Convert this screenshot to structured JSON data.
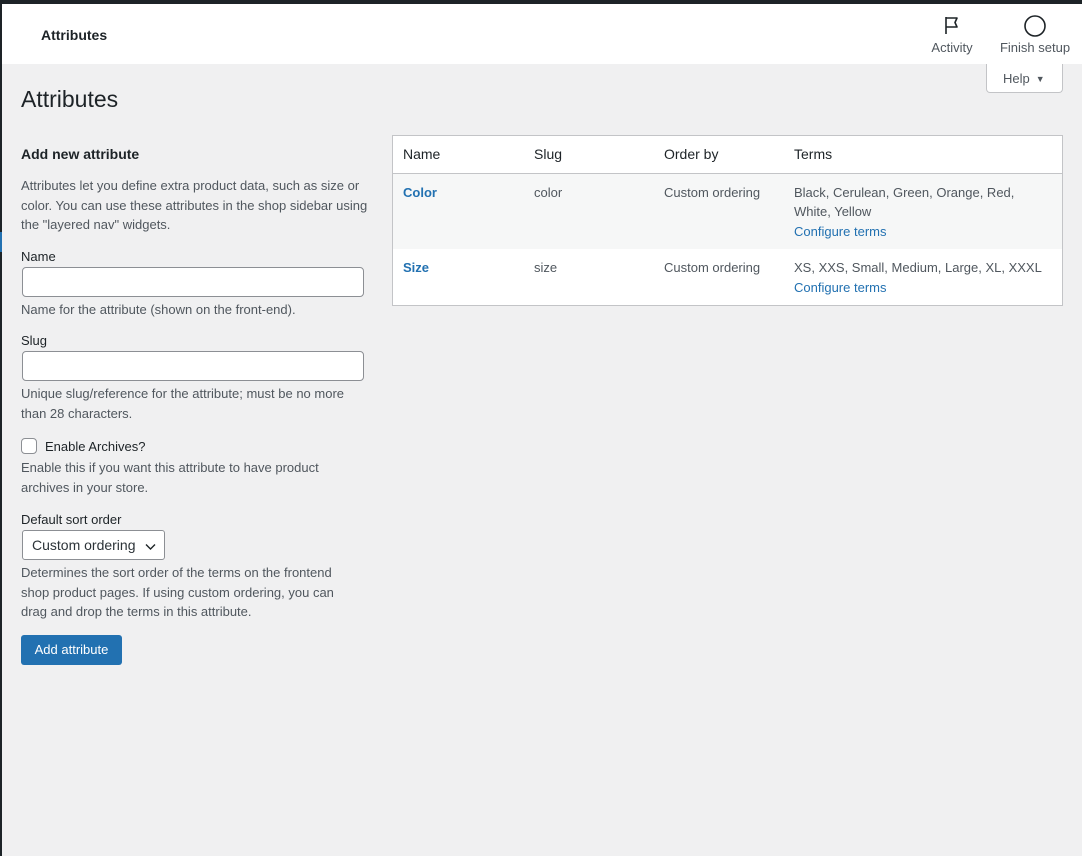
{
  "header": {
    "title": "Attributes",
    "activity_label": "Activity",
    "finish_setup_label": "Finish setup"
  },
  "help": {
    "label": "Help"
  },
  "page": {
    "title": "Attributes"
  },
  "form": {
    "heading": "Add new attribute",
    "intro": "Attributes let you define extra product data, such as size or color. You can use these attributes in the shop sidebar using the \"layered nav\" widgets.",
    "name_label": "Name",
    "name_value": "",
    "name_help": "Name for the attribute (shown on the front-end).",
    "slug_label": "Slug",
    "slug_value": "",
    "slug_help": "Unique slug/reference for the attribute; must be no more than 28 characters.",
    "archives_label": "Enable Archives?",
    "archives_checked": false,
    "archives_help": "Enable this if you want this attribute to have product archives in your store.",
    "sort_label": "Default sort order",
    "sort_value": "Custom ordering",
    "sort_help": "Determines the sort order of the terms on the frontend shop product pages. If using custom ordering, you can drag and drop the terms in this attribute.",
    "submit_label": "Add attribute"
  },
  "table": {
    "columns": [
      "Name",
      "Slug",
      "Order by",
      "Terms"
    ],
    "rows": [
      {
        "name": "Color",
        "slug": "color",
        "order_by": "Custom ordering",
        "terms": "Black, Cerulean, Green, Orange, Red, White, Yellow",
        "configure_label": "Configure terms"
      },
      {
        "name": "Size",
        "slug": "size",
        "order_by": "Custom ordering",
        "terms": "XS, XXS, Small, Medium, Large, XL, XXXL",
        "configure_label": "Configure terms"
      }
    ]
  },
  "colors": {
    "accent": "#2271b1",
    "text": "#1d2327",
    "muted": "#50575e",
    "background": "#f0f0f1"
  },
  "icons": {
    "activity": "flag-icon",
    "finish_setup": "circle-icon",
    "help": "caret-down-icon",
    "select": "chevron-down-icon"
  }
}
